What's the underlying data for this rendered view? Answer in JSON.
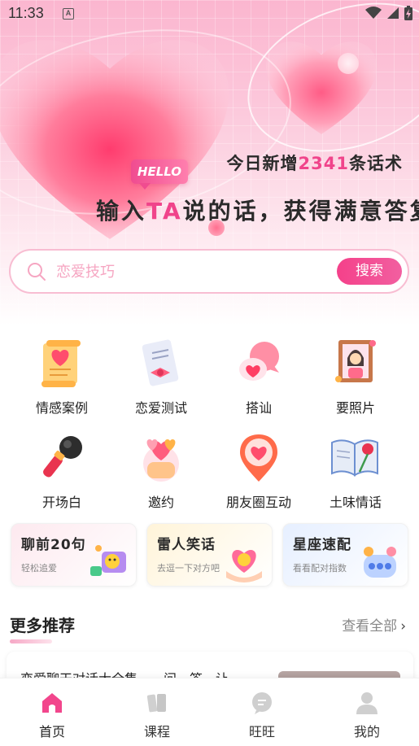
{
  "status_bar": {
    "time": "11:33",
    "notification_icon": "a-letter-icon",
    "wifi_icon": "wifi-icon",
    "signal_icon": "signal-icon",
    "battery_icon": "battery-charging-icon"
  },
  "hero": {
    "stats_prefix": "今日新增",
    "stats_count": "2341",
    "stats_suffix": "条话术",
    "badge": "HELLO",
    "headline_before": "输入",
    "headline_highlight": "TA",
    "headline_after": "说的话，获得满意答复"
  },
  "search": {
    "placeholder": "恋爱技巧",
    "button_label": "搜索"
  },
  "categories": [
    {
      "label": "情感案例",
      "icon": "scroll-heart-icon"
    },
    {
      "label": "恋爱测试",
      "icon": "letter-bow-icon"
    },
    {
      "label": "搭讪",
      "icon": "speech-bubble-heart-icon"
    },
    {
      "label": "要照片",
      "icon": "photo-frame-icon"
    },
    {
      "label": "开场白",
      "icon": "microphone-icon"
    },
    {
      "label": "邀约",
      "icon": "gift-hearts-icon"
    },
    {
      "label": "朋友圈互动",
      "icon": "location-heart-icon"
    },
    {
      "label": "土味情话",
      "icon": "book-rose-icon"
    }
  ],
  "promo_cards": [
    {
      "title": "聊前20句",
      "subtitle": "轻松追爱",
      "icon": "chat-smile-icon"
    },
    {
      "title": "雷人笑话",
      "subtitle": "去逗一下对方吧",
      "icon": "hands-heart-icon"
    },
    {
      "title": "星座速配",
      "subtitle": "看看配对指数",
      "icon": "constellation-chat-icon"
    }
  ],
  "more": {
    "title": "更多推荐",
    "view_all": "查看全部",
    "first_item_title": "恋爱聊天对话大全集，一问一答，让"
  },
  "tabs": [
    {
      "label": "首页",
      "icon": "home-icon",
      "active": true
    },
    {
      "label": "课程",
      "icon": "book-icon",
      "active": false
    },
    {
      "label": "旺旺",
      "icon": "chat-bubble-icon",
      "active": false
    },
    {
      "label": "我的",
      "icon": "user-icon",
      "active": false
    }
  ],
  "colors": {
    "accent": "#f0448b",
    "hero_pink": "#fbb6cf",
    "search_border": "#f8bdd2"
  }
}
